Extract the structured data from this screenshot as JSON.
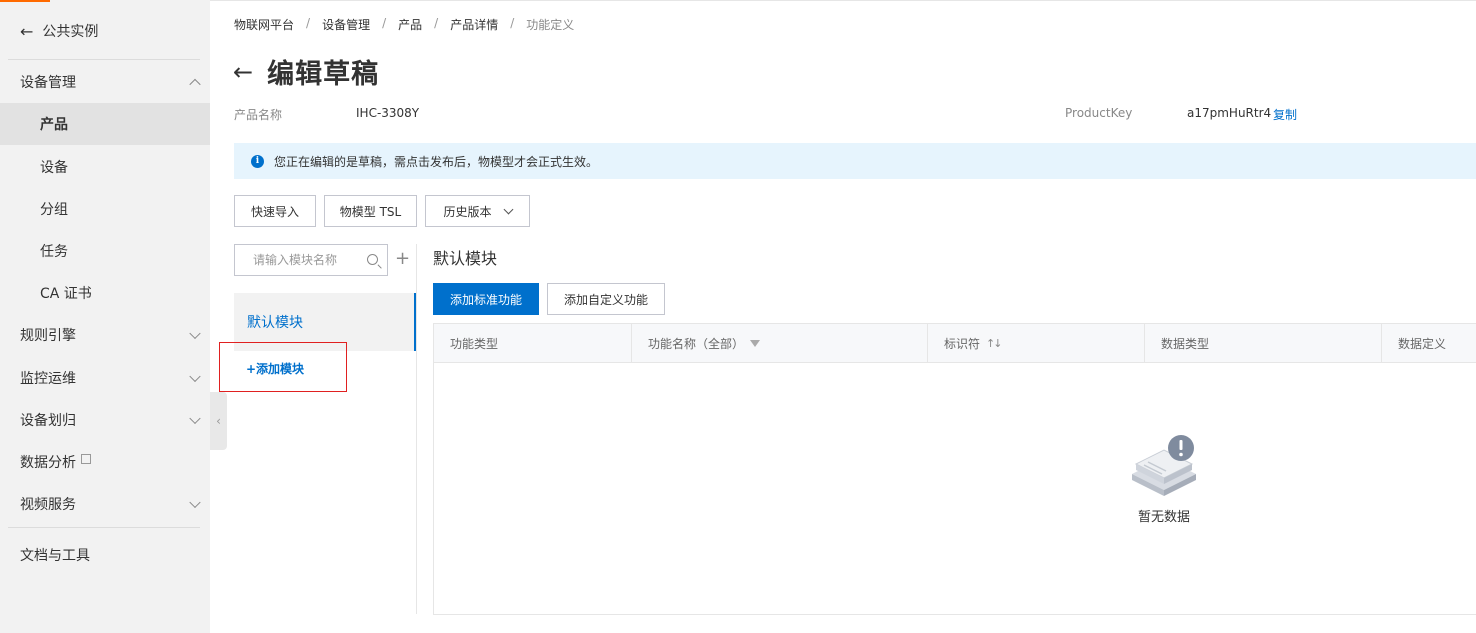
{
  "sidebar": {
    "back_label": "公共实例",
    "items": [
      {
        "label": "设备管理",
        "level": 1,
        "chevron": "up"
      },
      {
        "label": "产品",
        "level": 2,
        "active": true
      },
      {
        "label": "设备",
        "level": 2
      },
      {
        "label": "分组",
        "level": 2
      },
      {
        "label": "任务",
        "level": 2
      },
      {
        "label": "CA 证书",
        "level": 2
      },
      {
        "label": "规则引擎",
        "level": 1,
        "chevron": "down"
      },
      {
        "label": "监控运维",
        "level": 1,
        "chevron": "down"
      },
      {
        "label": "设备划归",
        "level": 1,
        "chevron": "down"
      },
      {
        "label": "数据分析",
        "level": 1,
        "external": true
      },
      {
        "label": "视频服务",
        "level": 1,
        "chevron": "down"
      },
      {
        "label": "文档与工具",
        "level": 1
      }
    ]
  },
  "breadcrumb": [
    "物联网平台",
    "设备管理",
    "产品",
    "产品详情",
    "功能定义"
  ],
  "page_title": "编辑草稿",
  "info": {
    "product_name_label": "产品名称",
    "product_name_value": "IHC-3308Y",
    "product_key_label": "ProductKey",
    "product_key_value": "a17pmHuRtr4",
    "copy_label": "复制"
  },
  "notice": "您正在编辑的是草稿，需点击发布后，物模型才会正式生效。",
  "toolbar": {
    "quick_import": "快速导入",
    "tsl": "物模型 TSL",
    "history": "历史版本"
  },
  "modules": {
    "search_placeholder": "请输入模块名称",
    "default_module": "默认模块",
    "add_module": "+添加模块"
  },
  "section_title": "默认模块",
  "actions": {
    "add_standard": "添加标准功能",
    "add_custom": "添加自定义功能"
  },
  "table": {
    "columns": [
      "功能类型",
      "功能名称（全部）",
      "标识符",
      "数据类型",
      "数据定义"
    ],
    "empty_text": "暂无数据"
  },
  "colors": {
    "accent": "#0070cc",
    "highlight_box": "#e02020",
    "notice_bg": "#e6f4fd",
    "sidebar_bg": "#f2f2f2"
  }
}
